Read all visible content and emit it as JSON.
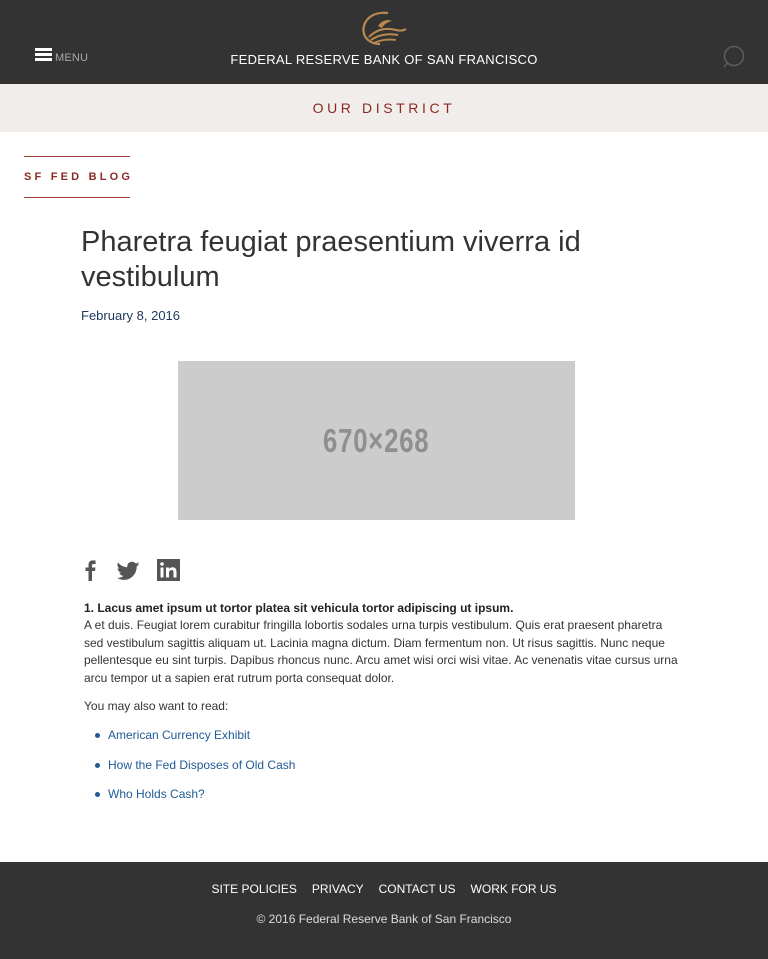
{
  "header": {
    "menu_label": "MENU",
    "bank_name": "FEDERAL RESERVE BANK OF SAN FRANCISCO",
    "icons": {
      "menu": "hamburger-icon",
      "logo": "eagle-logo",
      "search": "search-icon"
    },
    "logo_color": "#b98a4e"
  },
  "district": {
    "title": "OUR DISTRICT"
  },
  "blog": {
    "tag": "SF FED BLOG"
  },
  "article": {
    "title": "Pharetra feugiat praesentium viverra id vestibulum",
    "date": "February 8, 2016",
    "image_placeholder": "670×268",
    "social": [
      "facebook-icon",
      "twitter-icon",
      "linkedin-icon"
    ],
    "heading": "1. Lacus amet ipsum ut tortor platea sit vehicula tortor adipiscing ut ipsum.",
    "body": "A et duis. Feugiat lorem curabitur fringilla lobortis sodales urna turpis vestibulum. Quis erat praesent pharetra sed vestibulum sagittis aliquam ut. Lacinia magna dictum. Diam fermentum non. Ut risus sagittis. Nunc neque pellentesque eu sint turpis. Dapibus rhoncus nunc. Arcu amet wisi orci wisi vitae. Ac venenatis vitae cursus urna arcu tempor ut a sapien erat rutrum porta consequat dolor.",
    "also_read_label": "You may also want to read:",
    "related_links": [
      "American Currency Exhibit",
      "How the Fed Disposes of Old Cash",
      "Who Holds Cash?"
    ]
  },
  "footer": {
    "links": [
      "SITE POLICIES",
      "PRIVACY",
      "CONTACT US",
      "WORK FOR US"
    ],
    "copyright": "© 2016 Federal Reserve Bank of San Francisco"
  },
  "colors": {
    "header_bg": "#333333",
    "accent_red": "#8a2b23",
    "link_blue": "#1f5a96",
    "district_bg": "#f1edea"
  }
}
